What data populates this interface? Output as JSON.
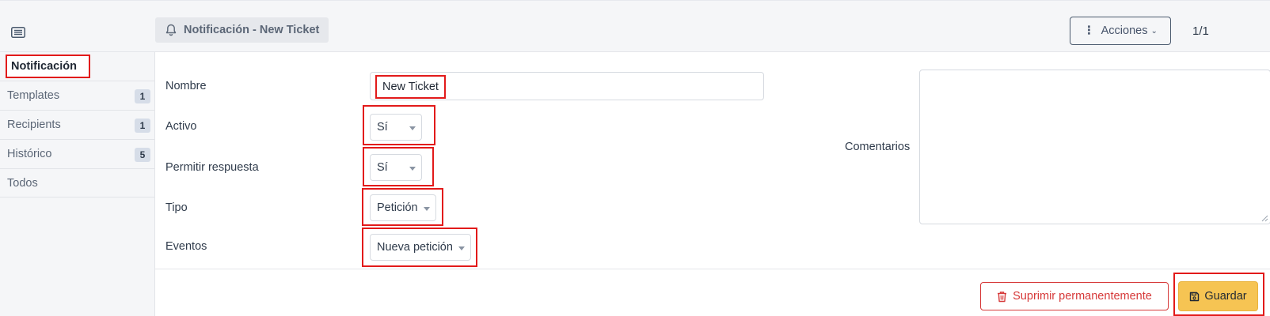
{
  "header": {
    "breadcrumb": "Notificación - New Ticket",
    "actions_label": "Acciones",
    "pager": "1/1"
  },
  "sidebar": {
    "active_tab": "Notificación",
    "items": [
      {
        "label": "Templates",
        "badge": "1"
      },
      {
        "label": "Recipients",
        "badge": "1"
      },
      {
        "label": "Histórico",
        "badge": "5"
      },
      {
        "label": "Todos",
        "badge": ""
      }
    ]
  },
  "form": {
    "nombre_label": "Nombre",
    "nombre_value": "New Ticket",
    "activo_label": "Activo",
    "activo_value": "Sí",
    "permitir_label": "Permitir respuesta",
    "permitir_value": "Sí",
    "tipo_label": "Tipo",
    "tipo_value": "Petición",
    "eventos_label": "Eventos",
    "eventos_value": "Nueva petición",
    "comentarios_label": "Comentarios",
    "comentarios_value": ""
  },
  "footer": {
    "delete_label": "Suprimir permanentemente",
    "save_label": "Guardar"
  },
  "colors": {
    "highlight": "#e21a1a",
    "danger": "#d63939",
    "save": "#f6c453"
  },
  "icons": [
    "list-icon",
    "bell-icon",
    "vertical-dots-icon",
    "chevron-down-icon",
    "trash-icon",
    "save-icon",
    "resize-grip-icon"
  ]
}
